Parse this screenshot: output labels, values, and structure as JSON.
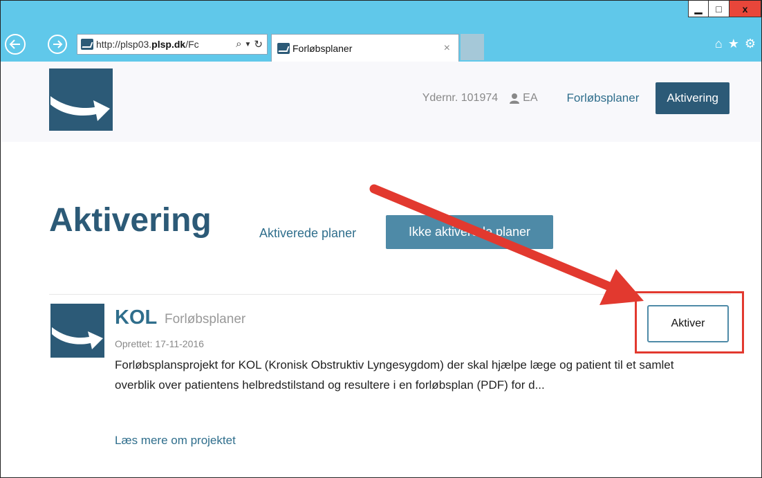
{
  "browser": {
    "url_prefix": "http://plsp03.",
    "url_domain": "plsp.dk",
    "url_suffix": "/Fc",
    "tab_title": "Forløbsplaner",
    "window_controls": {
      "minimize": "▁",
      "maximize": "□",
      "close": "x"
    }
  },
  "header": {
    "ydernr": "Ydernr. 101974",
    "user_initials": "EA",
    "nav_link": "Forløbsplaner",
    "nav_active": "Aktivering"
  },
  "page": {
    "title": "Aktivering",
    "tabs": [
      {
        "label": "Aktiverede planer",
        "active": false
      },
      {
        "label": "Ikke aktiverede planer",
        "active": true
      }
    ]
  },
  "project": {
    "title": "KOL",
    "subtitle": "Forløbsplaner",
    "created": "Oprettet: 17-11-2016",
    "description": "Forløbsplansprojekt for KOL (Kronisk Obstruktiv Lyngesygdom) der skal hjælpe læge og patient til et samlet overblik over patientens helbredstilstand og resultere i en forløbsplan (PDF) for d...",
    "more_link": "Læs mere om projektet",
    "action_label": "Aktiver"
  },
  "colors": {
    "browser_chrome": "#60c8ea",
    "brand_dark": "#2c5a77",
    "brand_mid": "#4e8aa7",
    "link": "#2f6e8c",
    "annotation_red": "#e2392f"
  }
}
